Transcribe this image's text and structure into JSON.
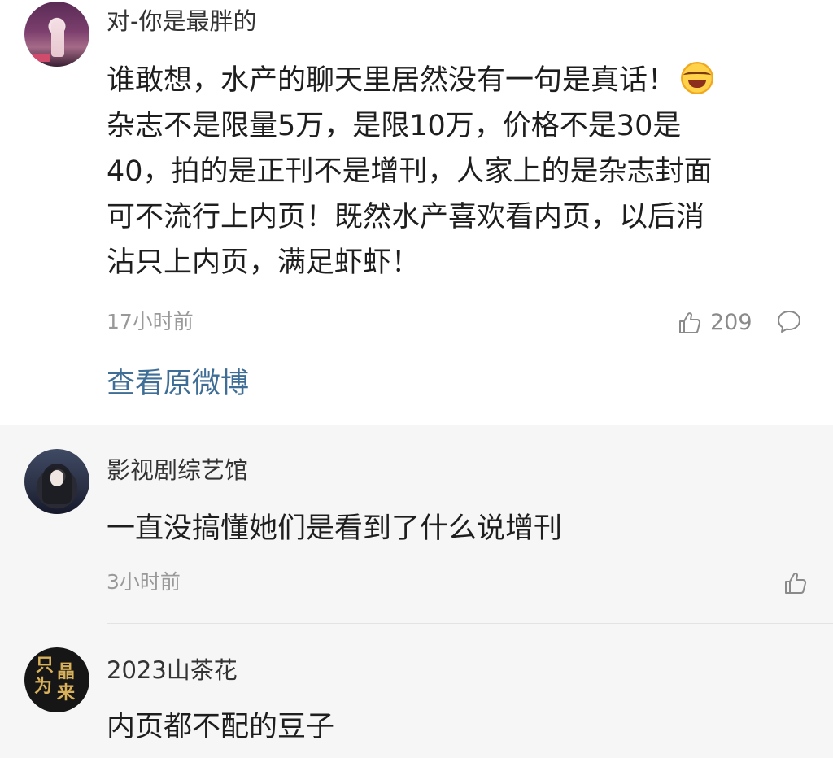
{
  "main_comment": {
    "username": "对-你是最胖的",
    "text_lines": [
      "谁敢想，水产的聊天里居然没有一句是真话！",
      "杂志不是限量5万，是限10万，价格不是30是",
      "40，拍的是正刊不是增刊，人家上的是杂志封面",
      "可不流行上内页！既然水产喜欢看内页，以后消",
      "沾只上内页，满足虾虾！"
    ],
    "emoji": "laughing-tears-emoji",
    "time": "17小时前",
    "like_count": "209",
    "view_original_label": "查看原微博"
  },
  "replies": [
    {
      "username": "影视剧综艺馆",
      "text": "一直没搞懂她们是看到了什么说增刊",
      "time": "3小时前"
    },
    {
      "username": "2023山茶花",
      "text": "内页都不配的豆子",
      "avatar_glyphs": [
        "只",
        "晶",
        "为",
        "来"
      ]
    }
  ],
  "colors": {
    "link": "#3e6d96",
    "meta": "#999999",
    "reply_background": "#f6f6f6",
    "avatar_glyph_gold": "#d8b15a"
  },
  "icons": {
    "like": "thumbs-up-icon",
    "reply": "comment-bubble-icon"
  }
}
